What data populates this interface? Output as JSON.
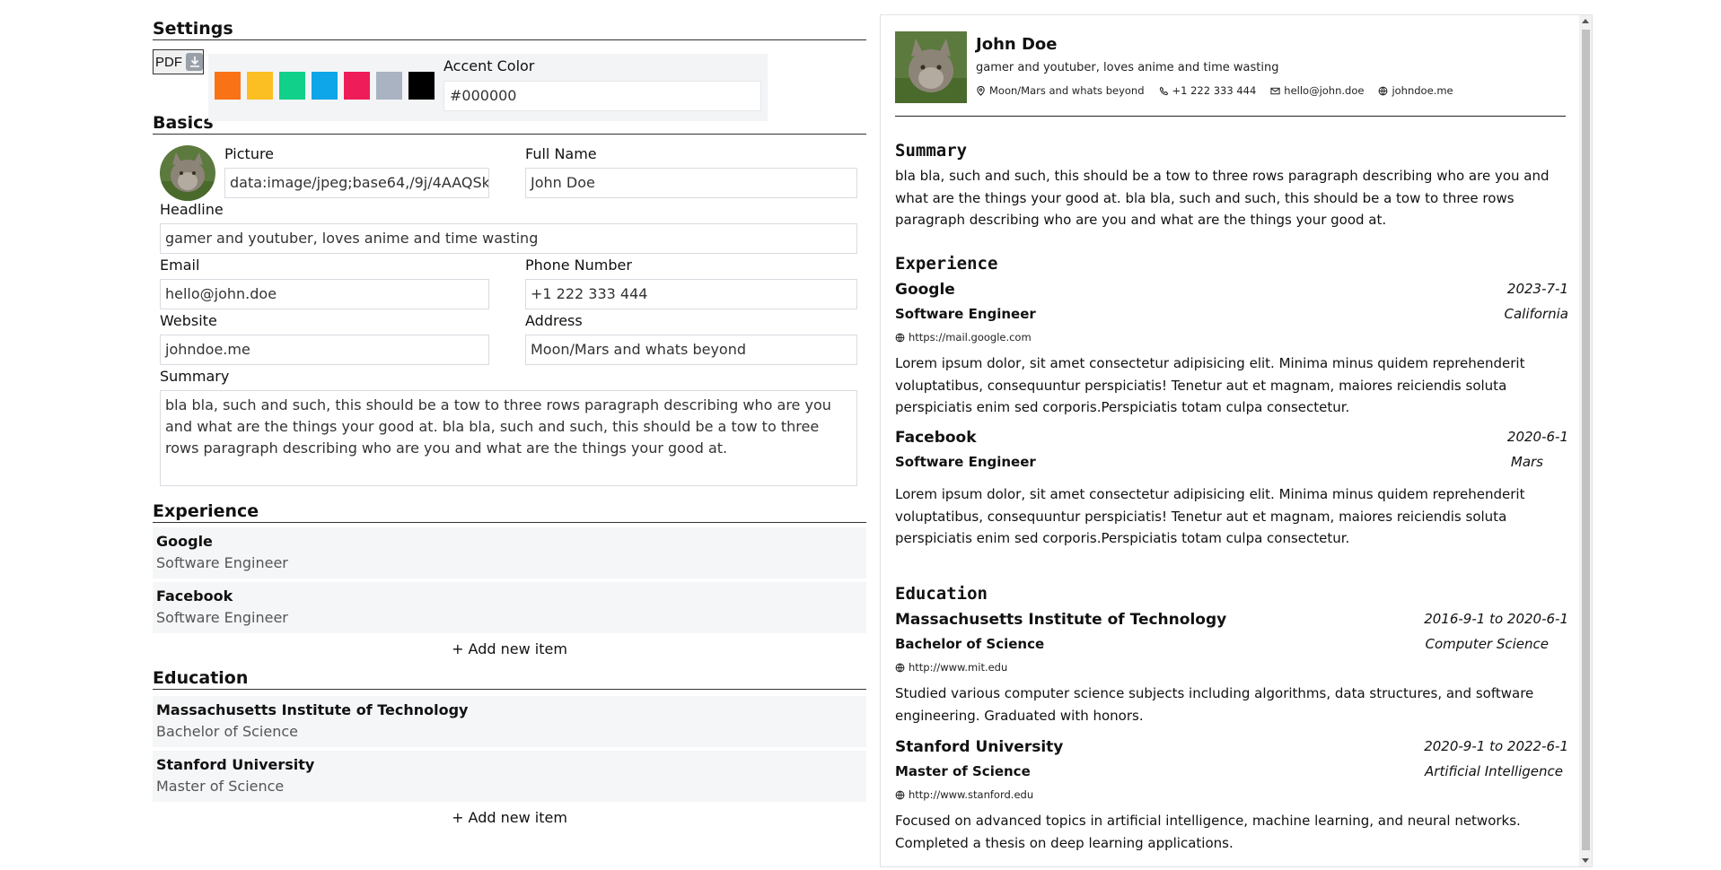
{
  "settings": {
    "title": "Settings",
    "pdf_label": "PDF",
    "swatches": [
      "#f97316",
      "#fbbf24",
      "#10d08a",
      "#0ea5e9",
      "#ef1c5a",
      "#a9b3c2",
      "#000000"
    ],
    "accent_label": "Accent Color",
    "accent_value": "#000000"
  },
  "basics": {
    "title": "Basics",
    "picture_label": "Picture",
    "picture_value": "data:image/jpeg;base64,/9j/4AAQSkZJRgABAQ",
    "fullname_label": "Full Name",
    "fullname_value": "John Doe",
    "headline_label": "Headline",
    "headline_value": "gamer and youtuber, loves anime and time wasting",
    "email_label": "Email",
    "email_value": "hello@john.doe",
    "phone_label": "Phone Number",
    "phone_value": "+1 222 333 444",
    "website_label": "Website",
    "website_value": "johndoe.me",
    "address_label": "Address",
    "address_value": "Moon/Mars and whats beyond",
    "summary_label": "Summary",
    "summary_value": "bla bla, such and such, this should be a tow to three rows paragraph describing who are you and what are the things your good at. bla bla, such and such, this should be a tow to three rows paragraph describing who are you and what are the things your good at."
  },
  "experience": {
    "title": "Experience",
    "items": [
      {
        "title": "Google",
        "subtitle": "Software Engineer"
      },
      {
        "title": "Facebook",
        "subtitle": "Software Engineer"
      }
    ],
    "add_label": "+ Add new item"
  },
  "education": {
    "title": "Education",
    "items": [
      {
        "title": "Massachusetts Institute of Technology",
        "subtitle": "Bachelor of Science"
      },
      {
        "title": "Stanford University",
        "subtitle": "Master of Science"
      }
    ],
    "add_label": "+ Add new item"
  },
  "preview": {
    "name": "John Doe",
    "headline": "gamer and youtuber, loves anime and time wasting",
    "location": "Moon/Mars and whats beyond",
    "phone": "+1 222 333 444",
    "email": "hello@john.doe",
    "website": "johndoe.me",
    "summary_title": "Summary",
    "summary": "bla bla, such and such, this should be a tow to three rows paragraph describing who are you and what are the things your good at. bla bla, such and such, this should be a tow to three rows paragraph describing who are you and what are the things your good at.",
    "experience_title": "Experience",
    "experience": [
      {
        "org": "Google",
        "date": "2023-7-1",
        "role": "Software Engineer",
        "location": "California",
        "url": "https://mail.google.com",
        "desc": "Lorem ipsum dolor, sit amet consectetur adipisicing elit. Minima minus quidem reprehenderit voluptatibus, consequuntur perspiciatis! Tenetur aut et magnam, maiores reiciendis soluta perspiciatis enim sed corporis.Perspiciatis totam culpa consectetur."
      },
      {
        "org": "Facebook",
        "date": "2020-6-1",
        "role": "Software Engineer",
        "location": "Mars",
        "desc": "Lorem ipsum dolor, sit amet consectetur adipisicing elit. Minima minus quidem reprehenderit voluptatibus, consequuntur perspiciatis! Tenetur aut et magnam, maiores reiciendis soluta perspiciatis enim sed corporis.Perspiciatis totam culpa consectetur."
      }
    ],
    "education_title": "Education",
    "education": [
      {
        "org": "Massachusetts Institute of Technology",
        "date": "2016-9-1 to 2020-6-1",
        "role": "Bachelor of Science",
        "area": "Computer Science",
        "url": "http://www.mit.edu",
        "desc": "Studied various computer science subjects including algorithms, data structures, and software engineering. Graduated with honors."
      },
      {
        "org": "Stanford University",
        "date": "2020-9-1 to 2022-6-1",
        "role": "Master of Science",
        "area": "Artificial Intelligence",
        "url": "http://www.stanford.edu",
        "desc": "Focused on advanced topics in artificial intelligence, machine learning, and neural networks. Completed a thesis on deep learning applications."
      }
    ]
  }
}
